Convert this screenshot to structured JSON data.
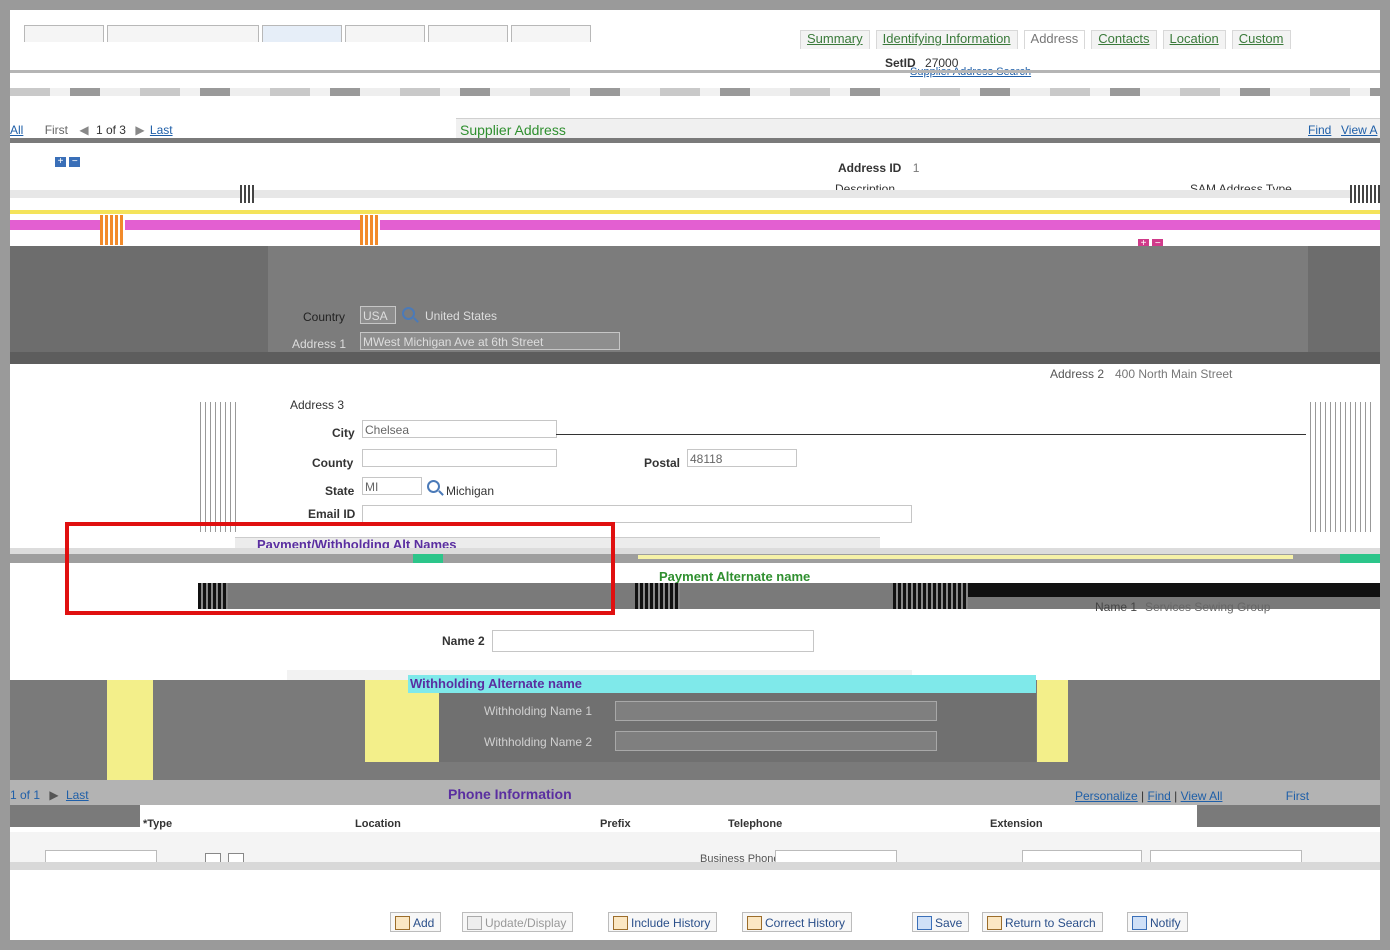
{
  "tabs": [
    "Summary",
    "Identifying Information",
    "Address",
    "Contacts",
    "Location",
    "Custom"
  ],
  "header": {
    "setid_label": "SetID",
    "setid_value": "27000",
    "link_text": "Supplier Address Search"
  },
  "nav": {
    "all": "All",
    "first": "First",
    "position": "1 of 3",
    "last": "Last"
  },
  "supplier_address": {
    "title": "Supplier Address",
    "find": "Find",
    "view": "View A"
  },
  "address": {
    "address_id_label": "Address ID",
    "address_id_value": "1",
    "description_label": "Description",
    "sam_address_type_label": "SAM Address Type",
    "country_label": "Country",
    "country_value": "USA",
    "country_name": "United States",
    "address1_label": "Address 1",
    "address1_value": "MWest Michigan Ave at 6th Street",
    "address2_label": "Address 2",
    "address2_value": "400 North Main Street",
    "address3_label": "Address 3",
    "city_label": "City",
    "city_value": "Chelsea",
    "county_label": "County",
    "county_value": "",
    "postal_label": "Postal",
    "postal_value": "48118",
    "state_label": "State",
    "state_value": "MI",
    "state_name": "Michigan",
    "email_label": "Email ID",
    "email_value": ""
  },
  "alt_names": {
    "section_title": "Payment/Withholding Alt Names",
    "payment_title": "Payment Alternate name",
    "name1_label": "Name 1",
    "name1_value": "Services Sewing Group",
    "name2_label": "Name 2",
    "name2_value": "",
    "withholding_title": "Withholding Alternate name",
    "wh_name1_label": "Withholding Name 1",
    "wh_name2_label": "Withholding Name 2"
  },
  "phone": {
    "title": "Phone Information",
    "personalize": "Personalize",
    "find": "Find",
    "view_all": "View All",
    "first": "First",
    "pos": "1 of 1",
    "last": "Last",
    "columns": [
      "*Type",
      "Location",
      "Prefix",
      "Telephone",
      "Extension"
    ],
    "row_type": "Business Phone"
  },
  "buttons": [
    "Add",
    "Update/Display",
    "Include History",
    "Correct History",
    "Save",
    "Return to Search",
    "Notify"
  ],
  "colors": {
    "accent_green": "#2f8f2f",
    "accent_purple": "#5a2ea0",
    "highlight_red": "#e01010"
  }
}
